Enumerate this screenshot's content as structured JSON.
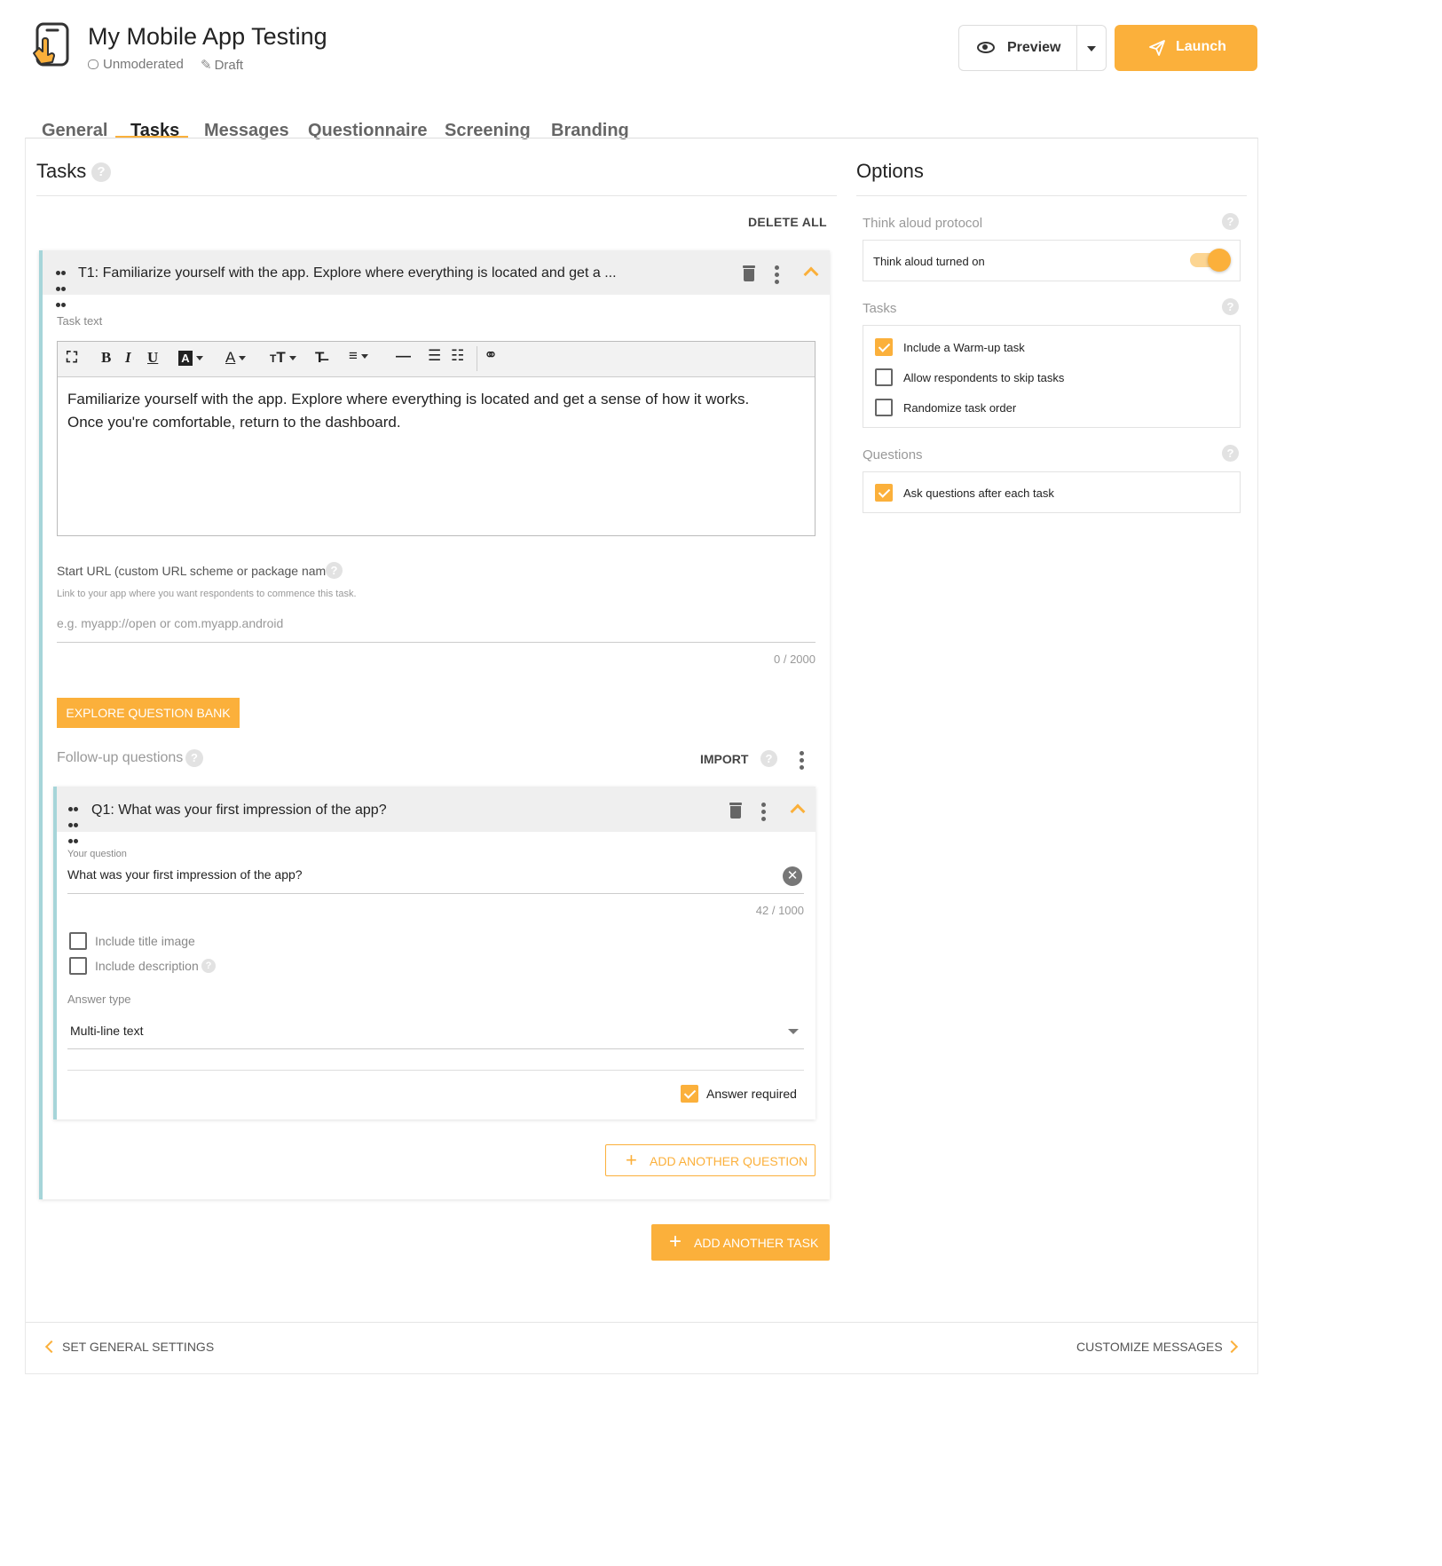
{
  "header": {
    "title": "My Mobile App Testing",
    "mode": "Unmoderated",
    "status": "Draft",
    "preview_label": "Preview",
    "launch_label": "Launch"
  },
  "tabs": [
    {
      "label": "General"
    },
    {
      "label": "Tasks"
    },
    {
      "label": "Messages"
    },
    {
      "label": "Questionnaire"
    },
    {
      "label": "Screening"
    },
    {
      "label": "Branding"
    }
  ],
  "tasks_panel": {
    "title": "Tasks",
    "delete_all": "DELETE ALL",
    "task": {
      "title": "T1: Familiarize yourself with the app. Explore where everything is located and get a ...",
      "task_text_label": "Task text",
      "body_line1": "Familiarize yourself with the app. Explore where everything is located and get a sense of how it works.",
      "body_line2": "Once you're comfortable, return to the dashboard.",
      "start_url_label": "Start URL (custom URL scheme or package name)",
      "start_url_hint": "Link to your app where you want respondents to commence this task.",
      "start_url_placeholder": "e.g. myapp://open or com.myapp.android",
      "start_url_counter": "0 / 2000",
      "explore_bank": "EXPLORE QUESTION BANK",
      "followup_label": "Follow-up questions",
      "import_label": "IMPORT",
      "question": {
        "title": "Q1: What was your first impression of the app?",
        "your_question_label": "Your question",
        "value": "What was your first impression of the app?",
        "counter": "42 / 1000",
        "include_title_image": "Include title image",
        "include_description": "Include description",
        "answer_type_label": "Answer type",
        "answer_type_value": "Multi-line text",
        "answer_required": "Answer required"
      },
      "add_question": "ADD ANOTHER QUESTION"
    },
    "add_task": "ADD ANOTHER TASK"
  },
  "options": {
    "title": "Options",
    "think_aloud_label": "Think aloud protocol",
    "think_aloud_value": "Think aloud turned on",
    "tasks_label": "Tasks",
    "warmup": "Include a Warm-up task",
    "skip": "Allow respondents to skip tasks",
    "randomize": "Randomize task order",
    "questions_label": "Questions",
    "ask_after": "Ask questions after each task"
  },
  "footer": {
    "prev": "SET GENERAL SETTINGS",
    "next": "CUSTOMIZE MESSAGES"
  },
  "colors": {
    "accent": "#fbb03b",
    "task_border": "#a6d5d9"
  }
}
